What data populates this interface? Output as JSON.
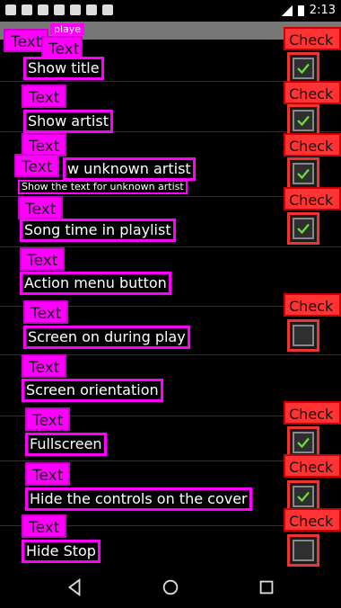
{
  "status": {
    "time": "2:13"
  },
  "appbar": {
    "title": "playe"
  },
  "tags": {
    "text": "Text",
    "check": "Check"
  },
  "rows": [
    {
      "label": "Show title",
      "checked": true
    },
    {
      "label": "Show artist",
      "checked": true
    },
    {
      "label": "w unknown artist",
      "sub": "Show the text for unknown artist",
      "checked": true
    },
    {
      "label": "Song time in playlist",
      "checked": true
    },
    {
      "label": "Action menu button"
    },
    {
      "label": "Screen on during play",
      "checked": false
    },
    {
      "label": "Screen orientation"
    },
    {
      "label": "Fullscreen",
      "checked": true
    },
    {
      "label": "Hide the controls on the cover",
      "checked": true
    },
    {
      "label": "Hide Stop",
      "checked": false
    }
  ],
  "colors": {
    "tag_magenta": "#ff00ff",
    "tag_red": "#ff3333",
    "check_green": "#6adf3a"
  }
}
